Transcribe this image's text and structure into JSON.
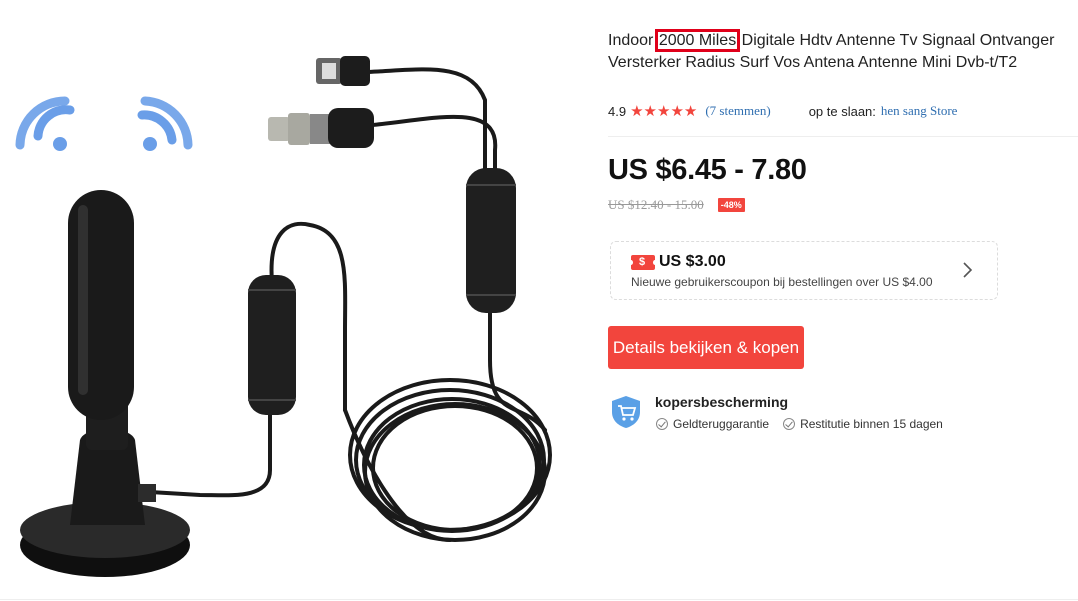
{
  "product": {
    "title_prefix": "Indoor",
    "title_highlight": "2000 Miles",
    "title_line1_rest": "Digitale Hdtv Antenne Tv Signaal Ontvanger",
    "title_line2": "Versterker Radius Surf Vos Antena Antenne Mini Dvb-t/T2",
    "image_icon": "antenna-product-photo"
  },
  "rating": {
    "score": "4.9",
    "stars": 5,
    "votes": "(7 stemmen)",
    "store_label": "op te slaan:",
    "store_name": "hen sang Store"
  },
  "pricing": {
    "price": "US $6.45 - 7.80",
    "old_price": "US $12.40 - 15.00",
    "discount": "-48%"
  },
  "coupon": {
    "icon": "coupon-icon",
    "icon_glyph": "$",
    "amount": "US $3.00",
    "description": "Nieuwe gebruikerscoupon bij bestellingen over US $4.00"
  },
  "actions": {
    "buy_label": "Details bekijken & kopen"
  },
  "protection": {
    "title": "kopersbescherming",
    "items": [
      "Geldteruggarantie",
      "Restitutie binnen 15 dagen"
    ]
  },
  "colors": {
    "accent_red": "#f2453d",
    "link_blue": "#2f6eb0",
    "highlight_box": "#e0001a",
    "wifi_blue": "#6a9ee8"
  }
}
